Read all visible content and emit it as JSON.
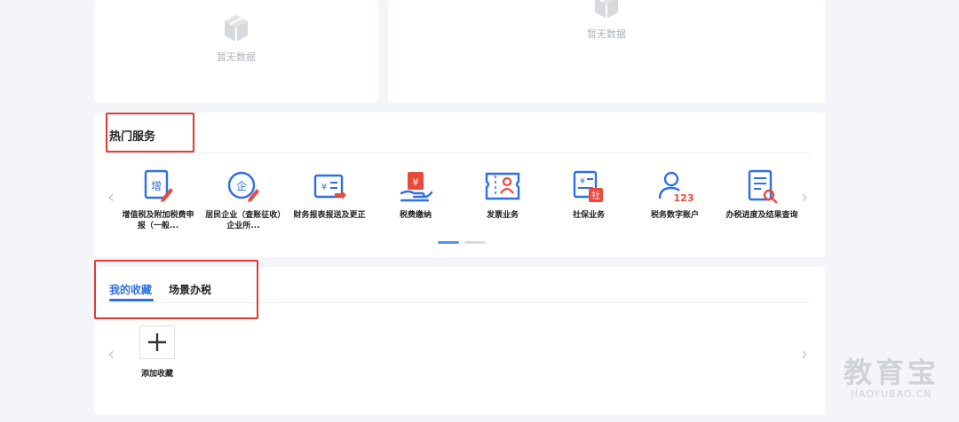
{
  "empty_panels": {
    "left_text": "暂无数据",
    "right_text": "暂无数据"
  },
  "hot_services": {
    "title": "热门服务",
    "items": [
      {
        "label": "增值税及附加税费申报（一般...",
        "icon": "vat-declare-icon"
      },
      {
        "label": "居民企业（查账征收）企业所...",
        "icon": "enterprise-tax-icon"
      },
      {
        "label": "财务报表报送及更正",
        "icon": "financial-report-icon"
      },
      {
        "label": "税费缴纳",
        "icon": "tax-payment-icon"
      },
      {
        "label": "发票业务",
        "icon": "invoice-icon"
      },
      {
        "label": "社保业务",
        "icon": "social-security-icon"
      },
      {
        "label": "税务数字账户",
        "icon": "digital-account-icon"
      },
      {
        "label": "办税进度及结果查询",
        "icon": "progress-query-icon"
      }
    ],
    "carousel_pages": 2,
    "active_page": 1
  },
  "favorites": {
    "tabs": [
      {
        "label": "我的收藏",
        "active": true
      },
      {
        "label": "场景办税",
        "active": false
      }
    ],
    "add_label": "添加收藏"
  },
  "watermark": {
    "brand": "教育宝",
    "domain": "JIAOYUBAO.CN"
  },
  "colors": {
    "accent": "#2f6fe4",
    "highlight_box": "#e8382f",
    "icon_red": "#e84a3c"
  }
}
